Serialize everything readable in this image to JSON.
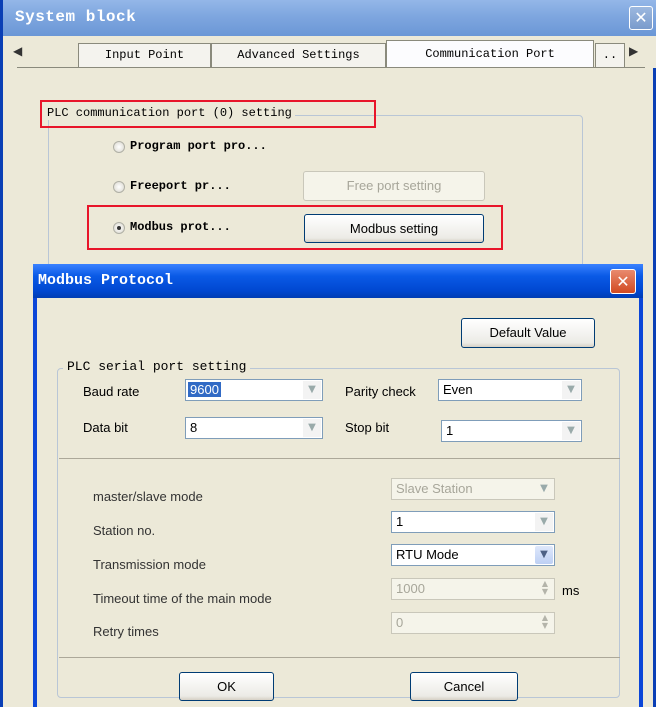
{
  "system_block": {
    "title": "System block",
    "close_glyph": "✕",
    "tabs": [
      {
        "label": "Input Point"
      },
      {
        "label": "Advanced Settings"
      },
      {
        "label": "Communication Port"
      },
      {
        "label": ".."
      }
    ],
    "active_tab": "Communication Port",
    "group_title": "PLC communication port (0) setting",
    "options": [
      {
        "label": "Program port pro...",
        "selected": false
      },
      {
        "label": "Freeport pr...",
        "selected": false,
        "button": "Free port setting",
        "button_enabled": false
      },
      {
        "label": "Modbus prot...",
        "selected": true,
        "button": "Modbus setting",
        "button_enabled": true
      }
    ]
  },
  "modbus_dialog": {
    "title": "Modbus Protocol",
    "close_glyph": "✕",
    "default_button": "Default Value",
    "group_title": "PLC serial port setting",
    "baud_rate": {
      "label": "Baud rate",
      "value": "9600"
    },
    "parity_check": {
      "label": "Parity check",
      "value": "Even"
    },
    "data_bit": {
      "label": "Data bit",
      "value": "8"
    },
    "stop_bit": {
      "label": "Stop bit",
      "value": "1"
    },
    "master_slave": {
      "label": "master/slave mode",
      "value": "Slave Station",
      "enabled": false
    },
    "station_no": {
      "label": "Station no.",
      "value": "1"
    },
    "transmission": {
      "label": "Transmission mode",
      "value": "RTU Mode"
    },
    "timeout": {
      "label": "Timeout time of the main mode",
      "value": "1000",
      "unit": "ms",
      "enabled": false
    },
    "retry": {
      "label": "Retry times",
      "value": "0",
      "enabled": false
    },
    "ok_button": "OK",
    "cancel_button": "Cancel"
  },
  "colors": {
    "highlight_box": "#e8152a",
    "dialog_title": "#0047d0",
    "selection": "#316ac5"
  }
}
